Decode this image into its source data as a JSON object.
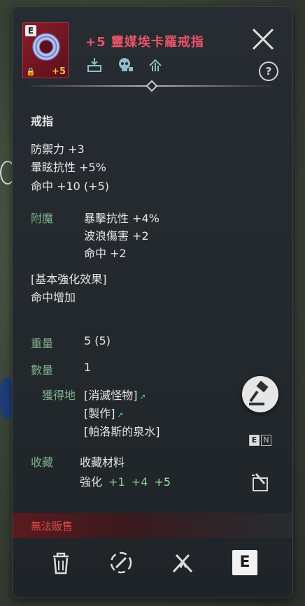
{
  "item": {
    "grade": "E",
    "enhance_badge": "+5",
    "title": "+5 靈媒埃卡羅戒指",
    "type": "戒指",
    "stats": [
      "防禦力 +3",
      "暈眩抗性 +5%",
      "命中 +10 (+5)"
    ],
    "enchant_label": "附魔",
    "enchant_stats": [
      "暴擊抗性 +4%",
      "波浪傷害 +2",
      "命中 +2"
    ],
    "basic_enhance_header": "[基本強化效果]",
    "basic_enhance_text": "命中增加",
    "weight_label": "重量",
    "weight_value": "5 (5)",
    "quantity_label": "數量",
    "quantity_value": "1",
    "source_label": "獲得地",
    "sources": [
      "[消滅怪物]",
      "[製作]",
      "[帕洛斯的泉水]"
    ],
    "collection_label": "收藏",
    "collection_value": "收藏材料",
    "enhance_label": "強化",
    "enhance_levels": [
      "+1",
      "+4",
      "+5"
    ],
    "unsellable": "無法販售"
  },
  "controls": {
    "help": "?",
    "lang_e": "E",
    "lang_n": "N",
    "equip_label": "E"
  },
  "colors": {
    "title": "#e8536a",
    "link": "#4fc3c8",
    "unsell": "#e24b4b",
    "panel": "#262c31"
  },
  "icons": [
    "close-icon",
    "help-icon",
    "storage-icon",
    "skull-icon",
    "upgrade-icon",
    "auction-gavel-icon",
    "memo-icon",
    "trash-icon",
    "refine-icon",
    "disassemble-icon"
  ]
}
